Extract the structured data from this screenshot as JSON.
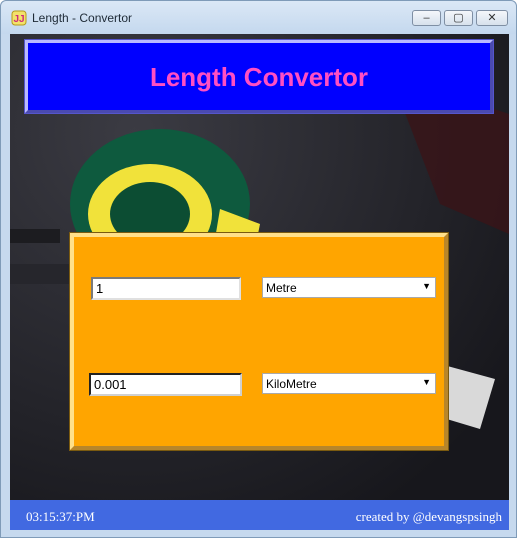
{
  "window": {
    "title": "Length - Convertor",
    "controls": {
      "minimize": "–",
      "maximize": "▢",
      "close": "✕"
    }
  },
  "header": {
    "title": "Length Convertor"
  },
  "converter": {
    "input_value": "1",
    "input_unit": "Metre",
    "output_value": "0.001",
    "output_unit": "KiloMetre"
  },
  "status": {
    "time": "03:15:37:PM",
    "credit": "created by @devangspsingh"
  },
  "colors": {
    "header_bg": "#0000ff",
    "header_text": "#ff4fc3",
    "panel_bg": "#ffa500",
    "status_bg": "#4169e1"
  },
  "icons": {
    "app": "app-logo-icon",
    "dropdown": "chevron-down-icon"
  }
}
